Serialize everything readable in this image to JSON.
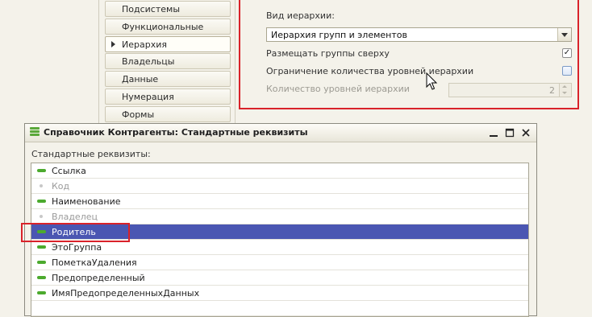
{
  "nav": {
    "items": [
      {
        "label": "Подсистемы",
        "active": false
      },
      {
        "label": "Функциональные опции",
        "active": false
      },
      {
        "label": "Иерархия",
        "active": true
      },
      {
        "label": "Владельцы",
        "active": false
      },
      {
        "label": "Данные",
        "active": false
      },
      {
        "label": "Нумерация",
        "active": false
      },
      {
        "label": "Формы",
        "active": false
      }
    ]
  },
  "hierarchy": {
    "kind_label": "Вид иерархии:",
    "kind_value": "Иерархия групп и элементов",
    "place_groups_top_label": "Размещать группы сверху",
    "place_groups_top_checked": true,
    "limit_levels_label": "Ограничение количества уровней иерархии",
    "limit_levels_checked": false,
    "levels_count_label": "Количество уровней иерархии",
    "levels_count_value": "2"
  },
  "dialog": {
    "title": "Справочник Контрагенты: Стандартные реквизиты",
    "subtitle": "Стандартные реквизиты:",
    "minimize_icon": "—",
    "maximize_icon": "☐",
    "close_icon": "✕",
    "rows": [
      {
        "label": "Ссылка",
        "icon": "green-bar",
        "dim": false,
        "selected": false
      },
      {
        "label": "Код",
        "icon": "gray-dot",
        "dim": true,
        "selected": false
      },
      {
        "label": "Наименование",
        "icon": "green-bar",
        "dim": false,
        "selected": false
      },
      {
        "label": "Владелец",
        "icon": "gray-dot",
        "dim": true,
        "selected": false
      },
      {
        "label": "Родитель",
        "icon": "green-bar",
        "dim": false,
        "selected": true
      },
      {
        "label": "ЭтоГруппа",
        "icon": "green-bar",
        "dim": false,
        "selected": false
      },
      {
        "label": "ПометкаУдаления",
        "icon": "green-bar",
        "dim": false,
        "selected": false
      },
      {
        "label": "Предопределенный",
        "icon": "green-bar",
        "dim": false,
        "selected": false
      },
      {
        "label": "ИмяПредопределенныхДанных",
        "icon": "green-bar",
        "dim": false,
        "selected": false
      }
    ]
  },
  "colors": {
    "selection": "#4a56b2",
    "highlight_frame": "#d9222a",
    "attribute_icon": "#4caa2e"
  }
}
